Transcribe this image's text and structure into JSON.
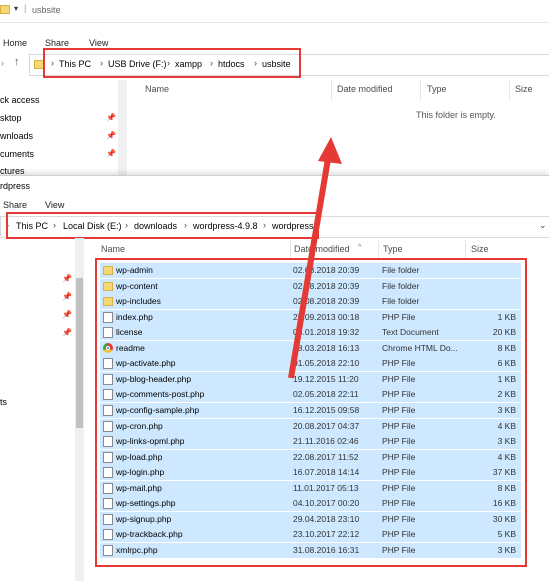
{
  "back_window": {
    "title": "usbsite",
    "tabs": [
      "Home",
      "Share",
      "View"
    ],
    "breadcrumbs": [
      "This PC",
      "USB Drive (F:)",
      "xampp",
      "htdocs",
      "usbsite"
    ],
    "nav_items": [
      "ck access",
      "sktop",
      "wnloads",
      "cuments",
      "ctures"
    ],
    "columns": [
      "Name",
      "Date modified",
      "Type",
      "Size"
    ],
    "empty_message": "This folder is empty."
  },
  "front_window": {
    "title": "rdpress",
    "tabs": [
      "Share",
      "View"
    ],
    "breadcrumbs": [
      "This PC",
      "Local Disk (E:)",
      "downloads",
      "wordpress-4.9.8",
      "wordpress"
    ],
    "nav_items": [
      "ts"
    ],
    "columns": [
      "Name",
      "Date modified",
      "Type",
      "Size"
    ],
    "files": [
      {
        "name": "wp-admin",
        "date": "02.08.2018 20:39",
        "type": "File folder",
        "size": "",
        "icon": "folder"
      },
      {
        "name": "wp-content",
        "date": "02.08.2018 20:39",
        "type": "File folder",
        "size": "",
        "icon": "folder"
      },
      {
        "name": "wp-includes",
        "date": "02.08.2018 20:39",
        "type": "File folder",
        "size": "",
        "icon": "folder"
      },
      {
        "name": "index.php",
        "date": "25.09.2013 00:18",
        "type": "PHP File",
        "size": "1 KB",
        "icon": "file"
      },
      {
        "name": "license",
        "date": "06.01.2018 19:32",
        "type": "Text Document",
        "size": "20 KB",
        "icon": "file"
      },
      {
        "name": "readme",
        "date": "18.03.2018 16:13",
        "type": "Chrome HTML Do...",
        "size": "8 KB",
        "icon": "chrome"
      },
      {
        "name": "wp-activate.php",
        "date": "01.05.2018 22:10",
        "type": "PHP File",
        "size": "6 KB",
        "icon": "file"
      },
      {
        "name": "wp-blog-header.php",
        "date": "19.12.2015 11:20",
        "type": "PHP File",
        "size": "1 KB",
        "icon": "file"
      },
      {
        "name": "wp-comments-post.php",
        "date": "02.05.2018 22:11",
        "type": "PHP File",
        "size": "2 KB",
        "icon": "file"
      },
      {
        "name": "wp-config-sample.php",
        "date": "16.12.2015 09:58",
        "type": "PHP File",
        "size": "3 KB",
        "icon": "file"
      },
      {
        "name": "wp-cron.php",
        "date": "20.08.2017 04:37",
        "type": "PHP File",
        "size": "4 KB",
        "icon": "file"
      },
      {
        "name": "wp-links-opml.php",
        "date": "21.11.2016 02:46",
        "type": "PHP File",
        "size": "3 KB",
        "icon": "file"
      },
      {
        "name": "wp-load.php",
        "date": "22.08.2017 11:52",
        "type": "PHP File",
        "size": "4 KB",
        "icon": "file"
      },
      {
        "name": "wp-login.php",
        "date": "16.07.2018 14:14",
        "type": "PHP File",
        "size": "37 KB",
        "icon": "file"
      },
      {
        "name": "wp-mail.php",
        "date": "11.01.2017 05:13",
        "type": "PHP File",
        "size": "8 KB",
        "icon": "file"
      },
      {
        "name": "wp-settings.php",
        "date": "04.10.2017 00:20",
        "type": "PHP File",
        "size": "16 KB",
        "icon": "file"
      },
      {
        "name": "wp-signup.php",
        "date": "29.04.2018 23:10",
        "type": "PHP File",
        "size": "30 KB",
        "icon": "file"
      },
      {
        "name": "wp-trackback.php",
        "date": "23.10.2017 22:12",
        "type": "PHP File",
        "size": "5 KB",
        "icon": "file"
      },
      {
        "name": "xmlrpc.php",
        "date": "31.08.2016 16:31",
        "type": "PHP File",
        "size": "3 KB",
        "icon": "file"
      }
    ]
  },
  "colors": {
    "selection": "#cde8ff",
    "annotation": "#e53935"
  }
}
